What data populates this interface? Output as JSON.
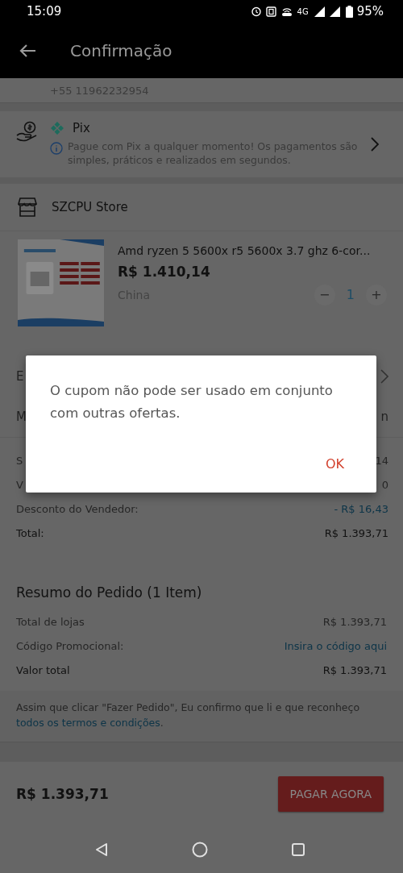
{
  "status_bar": {
    "time": "15:09",
    "network": "4G",
    "battery": "95%"
  },
  "app_bar": {
    "title": "Confirmação"
  },
  "address": {
    "phone": "+55 11962232954"
  },
  "payment": {
    "method": "Pix",
    "note": "Pague com Pix a qualquer momento! Os pagamentos são simples, práticos e realizados em segundos."
  },
  "store": {
    "name": "SZCPU Store",
    "product": {
      "title": "Amd ryzen 5 5600x r5 5600x 3.7 ghz 6-cor...",
      "price": "R$ 1.410,14",
      "origin": "China",
      "quantity": "1",
      "minus": "−",
      "plus": "+"
    },
    "options": [
      {
        "label": "E",
        "kind": "chevron"
      },
      {
        "label": "M",
        "value": "n",
        "kind": "text"
      }
    ],
    "lines": [
      {
        "label": "S",
        "value": "14",
        "kind": "muted"
      },
      {
        "label": "V",
        "value": "0",
        "kind": "muted"
      },
      {
        "label": "Desconto do Vendedor:",
        "value": "- R$ 16,43",
        "kind": "discount"
      },
      {
        "label": "Total:",
        "value": "R$ 1.393,71",
        "kind": "total"
      }
    ]
  },
  "summary": {
    "title": "Resumo do Pedido (1 Item)",
    "lines": [
      {
        "label": "Total de lojas",
        "value": "R$ 1.393,71",
        "kind": "muted"
      },
      {
        "label": "Código Promocional:",
        "value": "Insira o código aqui",
        "kind": "link"
      },
      {
        "label": "Valor total",
        "value": "R$ 1.393,71",
        "kind": "total"
      }
    ],
    "terms": "Assim que clicar \"Fazer Pedido\", Eu confirmo que li e que reconheço",
    "terms_link": "todos os termos e condições",
    "terms_end": "."
  },
  "bottom_bar": {
    "total": "R$ 1.393,71",
    "pay_button": "PAGAR AGORA"
  },
  "dialog": {
    "message": "O cupom não pode ser usado em conjunto com outras ofertas.",
    "button": "OK"
  }
}
